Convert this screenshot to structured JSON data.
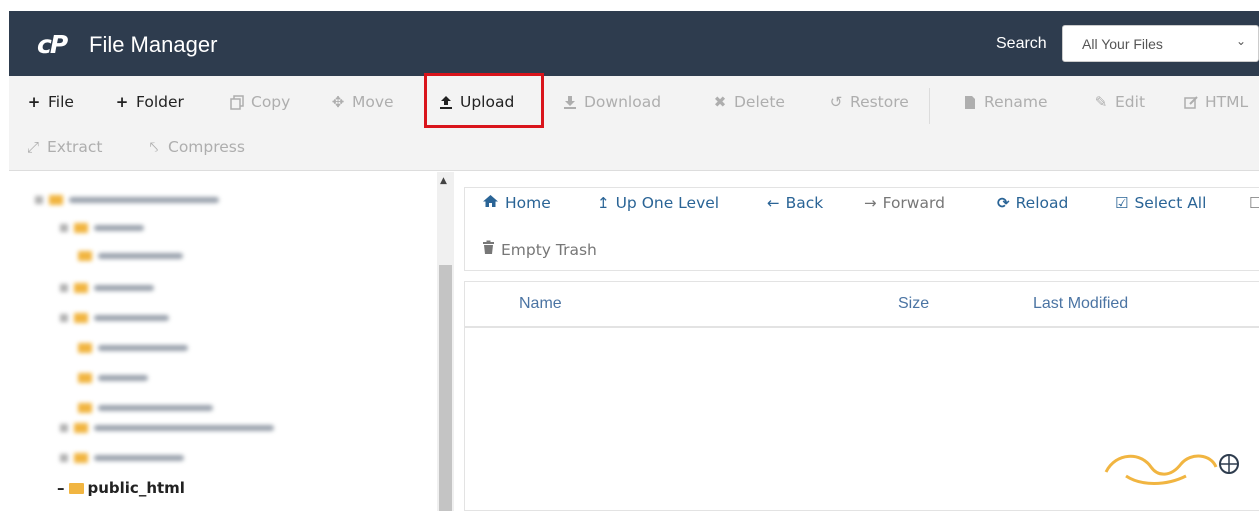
{
  "header": {
    "logo_text": "cP",
    "title": "File Manager",
    "search_label": "Search",
    "search_value": "All Your Files"
  },
  "toolbar": {
    "row1": [
      {
        "label": "File",
        "icon": "plus-icon",
        "state": "enabled"
      },
      {
        "label": "Folder",
        "icon": "plus-icon",
        "state": "enabled"
      },
      {
        "label": "Copy",
        "icon": "copy-icon",
        "state": "disabled"
      },
      {
        "label": "Move",
        "icon": "move-icon",
        "state": "disabled"
      },
      {
        "label": "Upload",
        "icon": "upload-icon",
        "state": "enabled",
        "highlighted": true
      },
      {
        "label": "Download",
        "icon": "download-icon",
        "state": "disabled"
      },
      {
        "label": "Delete",
        "icon": "close-icon",
        "state": "disabled"
      },
      {
        "label": "Restore",
        "icon": "undo-icon",
        "state": "disabled"
      },
      {
        "label": "Rename",
        "icon": "file-icon",
        "state": "disabled"
      },
      {
        "label": "Edit",
        "icon": "pencil-icon",
        "state": "disabled"
      },
      {
        "label": "HTML",
        "icon": "html-edit-icon",
        "state": "disabled"
      }
    ],
    "row2": [
      {
        "label": "Extract",
        "icon": "expand-icon",
        "state": "disabled"
      },
      {
        "label": "Compress",
        "icon": "compress-icon",
        "state": "disabled"
      }
    ]
  },
  "tree": {
    "current_folder": "public_html"
  },
  "nav": {
    "home": "Home",
    "up_one_level": "Up One Level",
    "back": "Back",
    "forward": "Forward",
    "reload": "Reload",
    "select_all": "Select All",
    "empty_trash": "Empty Trash"
  },
  "table": {
    "columns": [
      "Name",
      "Size",
      "Last Modified"
    ]
  },
  "colors": {
    "header_bg": "#2e3c4e",
    "toolbar_bg": "#f3f3f3",
    "link_blue": "#2a6496",
    "highlight_red": "#d9141b",
    "folder_yellow": "#f1b541"
  }
}
